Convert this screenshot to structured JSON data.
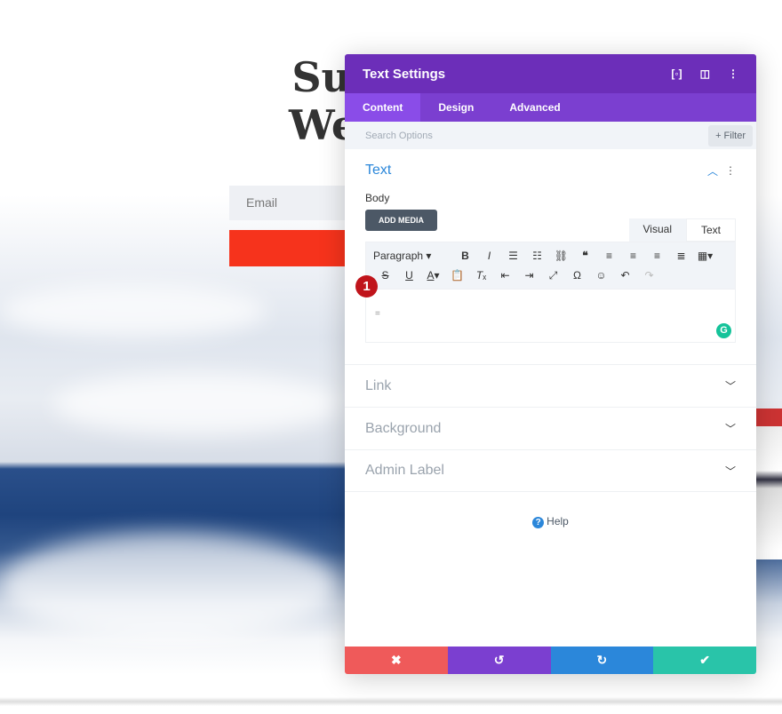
{
  "page": {
    "headline_lines": [
      "Su",
      "We"
    ],
    "email_placeholder": "Email"
  },
  "panel": {
    "title": "Text Settings",
    "header_icons": [
      "expand-icon",
      "split-view-icon",
      "more-icon"
    ],
    "tabs": [
      {
        "label": "Content",
        "active": true
      },
      {
        "label": "Design"
      },
      {
        "label": "Advanced"
      }
    ],
    "search_placeholder": "Search Options",
    "filter_label": "+ Filter",
    "text_section": {
      "title": "Text",
      "body_label": "Body",
      "add_media": "ADD MEDIA",
      "visual_tab": "Visual",
      "text_tab": "Text",
      "format_select": "Paragraph",
      "editor_content": "="
    },
    "badge": "1",
    "collapsed_sections": [
      "Link",
      "Background",
      "Admin Label"
    ],
    "help": "Help",
    "colors": {
      "header": "#6c2eb9",
      "tabs": "#7b3fd0",
      "cancel": "#ef5a5a",
      "undo": "#7b3fd0",
      "redo": "#2b87da",
      "save": "#29c4a9"
    }
  }
}
